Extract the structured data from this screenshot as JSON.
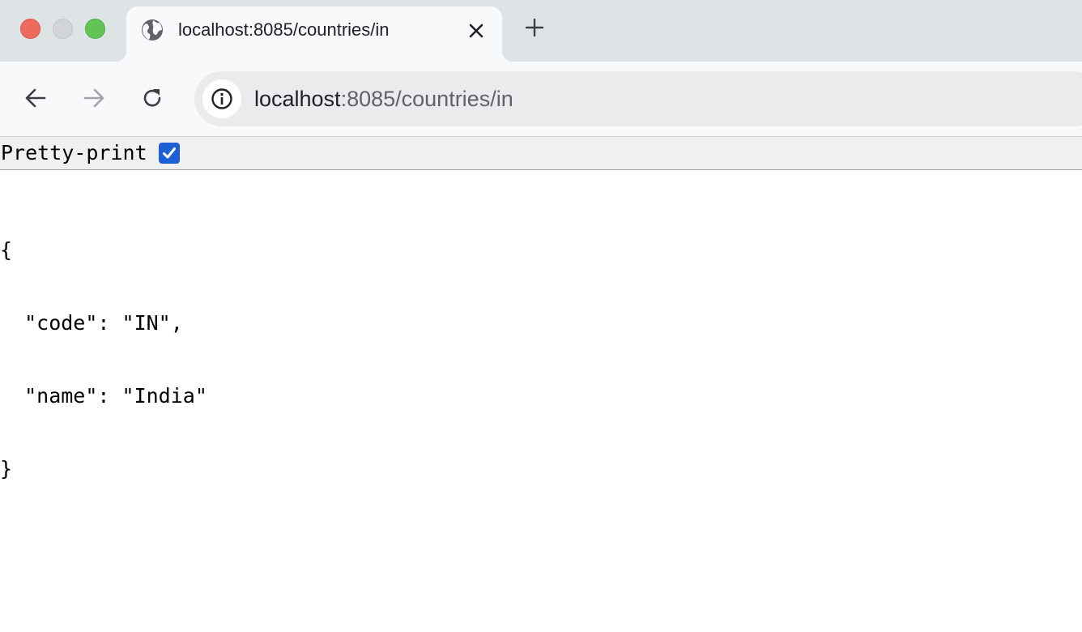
{
  "browser": {
    "tab": {
      "title": "localhost:8085/countries/in",
      "favicon": "globe-icon"
    },
    "new_tab_icon": "plus-icon",
    "address_bar": {
      "host": "localhost",
      "path": ":8085/countries/in",
      "site_info_icon": "info-icon"
    },
    "nav": {
      "back_icon": "arrow-left-icon",
      "forward_icon": "arrow-right-icon",
      "reload_icon": "reload-icon"
    }
  },
  "viewer": {
    "pretty_print_label": "Pretty-print",
    "pretty_print_checked": true,
    "json_lines": [
      "{",
      "  \"code\": \"IN\",",
      "  \"name\": \"India\"",
      "}"
    ]
  },
  "colors": {
    "tab_strip": "#dee3e6",
    "toolbar": "#f8f9fa",
    "omnibox": "#e9ebed",
    "checkbox_accent": "#1f5fd6",
    "traffic_close": "#ec6b5e",
    "traffic_minimize": "#d2d4d6",
    "traffic_zoom": "#61c454"
  }
}
